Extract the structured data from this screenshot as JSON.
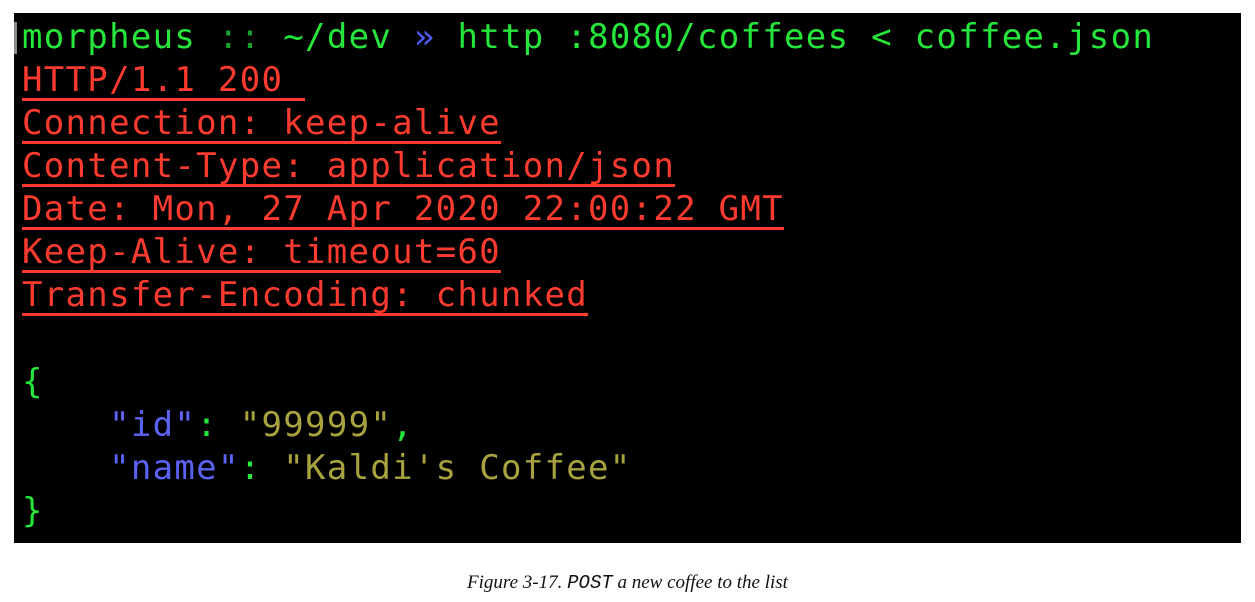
{
  "terminal": {
    "prompt": {
      "user": "morpheus",
      "separator": "::",
      "path": "~/dev",
      "arrow": "»",
      "command": "http :8080/coffees < coffee.json"
    },
    "headers": [
      "HTTP/1.1 200 ",
      "Connection: keep-alive",
      "Content-Type: application/json",
      "Date: Mon, 27 Apr 2020 22:00:22 GMT",
      "Keep-Alive: timeout=60",
      "Transfer-Encoding: chunked"
    ],
    "body": {
      "open_brace": "{",
      "close_brace": "}",
      "fields": [
        {
          "key": "\"id\"",
          "value": "\"99999\"",
          "trailing": ","
        },
        {
          "key": "\"name\"",
          "value": "\"Kaldi's Coffee\"",
          "trailing": ""
        }
      ]
    }
  },
  "caption": {
    "prefix": "Figure 3-17. ",
    "code": "POST",
    "suffix": " a new coffee to the list"
  },
  "colors": {
    "background": "#000000",
    "prompt_green": "#25e63a",
    "header_red": "#ff3b2f",
    "json_key_blue": "#5b63f4",
    "json_value_olive": "#a8a33e"
  }
}
